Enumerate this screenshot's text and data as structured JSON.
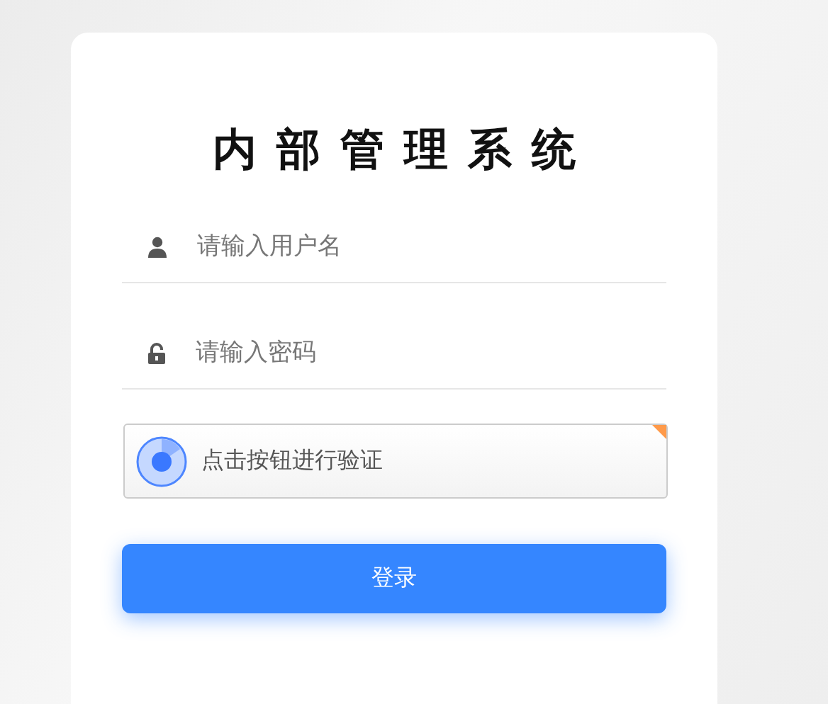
{
  "title": "内部管理系统",
  "username": {
    "placeholder": "请输入用户名"
  },
  "password": {
    "placeholder": "请输入密码"
  },
  "captcha": {
    "label": "点击按钮进行验证"
  },
  "login_button": "登录"
}
